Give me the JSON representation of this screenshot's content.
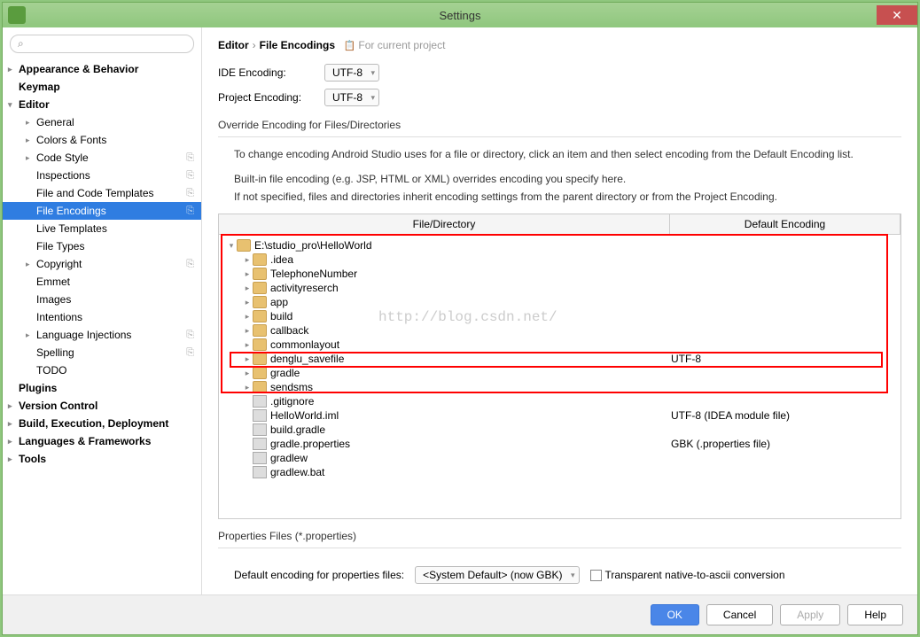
{
  "title": "Settings",
  "search": {
    "placeholder": ""
  },
  "sidebar": {
    "items": [
      {
        "label": "Appearance & Behavior",
        "level": 0,
        "arrow": "▸"
      },
      {
        "label": "Keymap",
        "level": 0
      },
      {
        "label": "Editor",
        "level": 0,
        "arrow": "▾"
      },
      {
        "label": "General",
        "level": 1,
        "arrow": "▸"
      },
      {
        "label": "Colors & Fonts",
        "level": 1,
        "arrow": "▸"
      },
      {
        "label": "Code Style",
        "level": 1,
        "arrow": "▸",
        "copy": true
      },
      {
        "label": "Inspections",
        "level": 1,
        "copy": true
      },
      {
        "label": "File and Code Templates",
        "level": 1,
        "copy": true
      },
      {
        "label": "File Encodings",
        "level": 1,
        "copy": true,
        "selected": true
      },
      {
        "label": "Live Templates",
        "level": 1
      },
      {
        "label": "File Types",
        "level": 1
      },
      {
        "label": "Copyright",
        "level": 1,
        "arrow": "▸",
        "copy": true
      },
      {
        "label": "Emmet",
        "level": 1
      },
      {
        "label": "Images",
        "level": 1
      },
      {
        "label": "Intentions",
        "level": 1
      },
      {
        "label": "Language Injections",
        "level": 1,
        "arrow": "▸",
        "copy": true
      },
      {
        "label": "Spelling",
        "level": 1,
        "copy": true
      },
      {
        "label": "TODO",
        "level": 1
      },
      {
        "label": "Plugins",
        "level": 0
      },
      {
        "label": "Version Control",
        "level": 0,
        "arrow": "▸"
      },
      {
        "label": "Build, Execution, Deployment",
        "level": 0,
        "arrow": "▸"
      },
      {
        "label": "Languages & Frameworks",
        "level": 0,
        "arrow": "▸"
      },
      {
        "label": "Tools",
        "level": 0,
        "arrow": "▸"
      }
    ]
  },
  "breadcrumb": {
    "a": "Editor",
    "b": "File Encodings",
    "proj": "For current project"
  },
  "encoding": {
    "ide_label": "IDE Encoding:",
    "ide_value": "UTF-8",
    "proj_label": "Project Encoding:",
    "proj_value": "UTF-8"
  },
  "override_title": "Override Encoding for Files/Directories",
  "help1": "To change encoding Android Studio uses for a file or directory, click an item and then select encoding from the Default Encoding list.",
  "help2": "Built-in file encoding (e.g. JSP, HTML or XML) overrides encoding you specify here.",
  "help3": "If not specified, files and directories inherit encoding settings from the parent directory or from the Project Encoding.",
  "table": {
    "col1": "File/Directory",
    "col2": "Default Encoding",
    "rows": [
      {
        "indent": 0,
        "arrow": "▾",
        "icon": "folder",
        "label": "E:\\studio_pro\\HelloWorld"
      },
      {
        "indent": 1,
        "arrow": "▸",
        "icon": "folder",
        "label": ".idea"
      },
      {
        "indent": 1,
        "arrow": "▸",
        "icon": "folder",
        "label": "TelephoneNumber"
      },
      {
        "indent": 1,
        "arrow": "▸",
        "icon": "folder",
        "label": "activityreserch"
      },
      {
        "indent": 1,
        "arrow": "▸",
        "icon": "folder",
        "label": "app"
      },
      {
        "indent": 1,
        "arrow": "▸",
        "icon": "folder",
        "label": "build"
      },
      {
        "indent": 1,
        "arrow": "▸",
        "icon": "folder",
        "label": "callback"
      },
      {
        "indent": 1,
        "arrow": "▸",
        "icon": "folder",
        "label": "commonlayout"
      },
      {
        "indent": 1,
        "arrow": "▸",
        "icon": "folder",
        "label": "denglu_savefile",
        "enc": "UTF-8"
      },
      {
        "indent": 1,
        "arrow": "▸",
        "icon": "folder",
        "label": "gradle"
      },
      {
        "indent": 1,
        "arrow": "▸",
        "icon": "folder",
        "label": "sendsms"
      },
      {
        "indent": 1,
        "arrow": "",
        "icon": "file",
        "label": ".gitignore"
      },
      {
        "indent": 1,
        "arrow": "",
        "icon": "file",
        "label": "HelloWorld.iml",
        "enc": "UTF-8 (IDEA module file)"
      },
      {
        "indent": 1,
        "arrow": "",
        "icon": "file",
        "label": "build.gradle"
      },
      {
        "indent": 1,
        "arrow": "",
        "icon": "file",
        "label": "gradle.properties",
        "enc": "GBK (.properties file)"
      },
      {
        "indent": 1,
        "arrow": "",
        "icon": "file",
        "label": "gradlew"
      },
      {
        "indent": 1,
        "arrow": "",
        "icon": "file",
        "label": "gradlew.bat"
      }
    ]
  },
  "props_title": "Properties Files (*.properties)",
  "props_label": "Default encoding for properties files:",
  "props_value": "<System Default> (now GBK)",
  "transparent_label": "Transparent native-to-ascii conversion",
  "buttons": {
    "ok": "OK",
    "cancel": "Cancel",
    "apply": "Apply",
    "help": "Help"
  },
  "watermark": "http://blog.csdn.net/"
}
